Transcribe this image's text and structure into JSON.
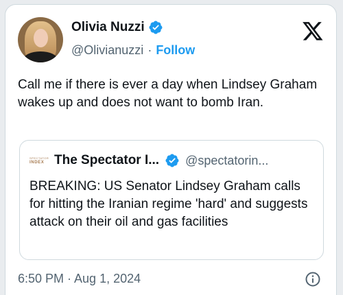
{
  "author": {
    "display_name": "Olivia Nuzzi",
    "handle": "@Olivianuzzi",
    "separator": "·",
    "follow_label": "Follow",
    "verified": true
  },
  "tweet": {
    "text": "Call me if there is ever a day when Lindsey Graham wakes up and does not want to bomb Iran.",
    "timestamp": "6:50 PM · Aug 1, 2024"
  },
  "quoted_tweet": {
    "logo_line1": "SPECTATOR",
    "logo_line2": "INDEX",
    "display_name": "The Spectator I...",
    "handle": "@spectatorin...",
    "verified": true,
    "text": "BREAKING: US Senator Lindsey Graham calls for hitting the Iranian regime 'hard' and suggests attack on their oil and gas facilities"
  },
  "icons": {
    "platform": "x-logo-icon",
    "verified": "verified-badge-icon",
    "info": "info-icon"
  },
  "colors": {
    "accent": "#1d9bf0",
    "text": "#0f1419",
    "muted": "#536471",
    "border": "#cfd9de"
  }
}
